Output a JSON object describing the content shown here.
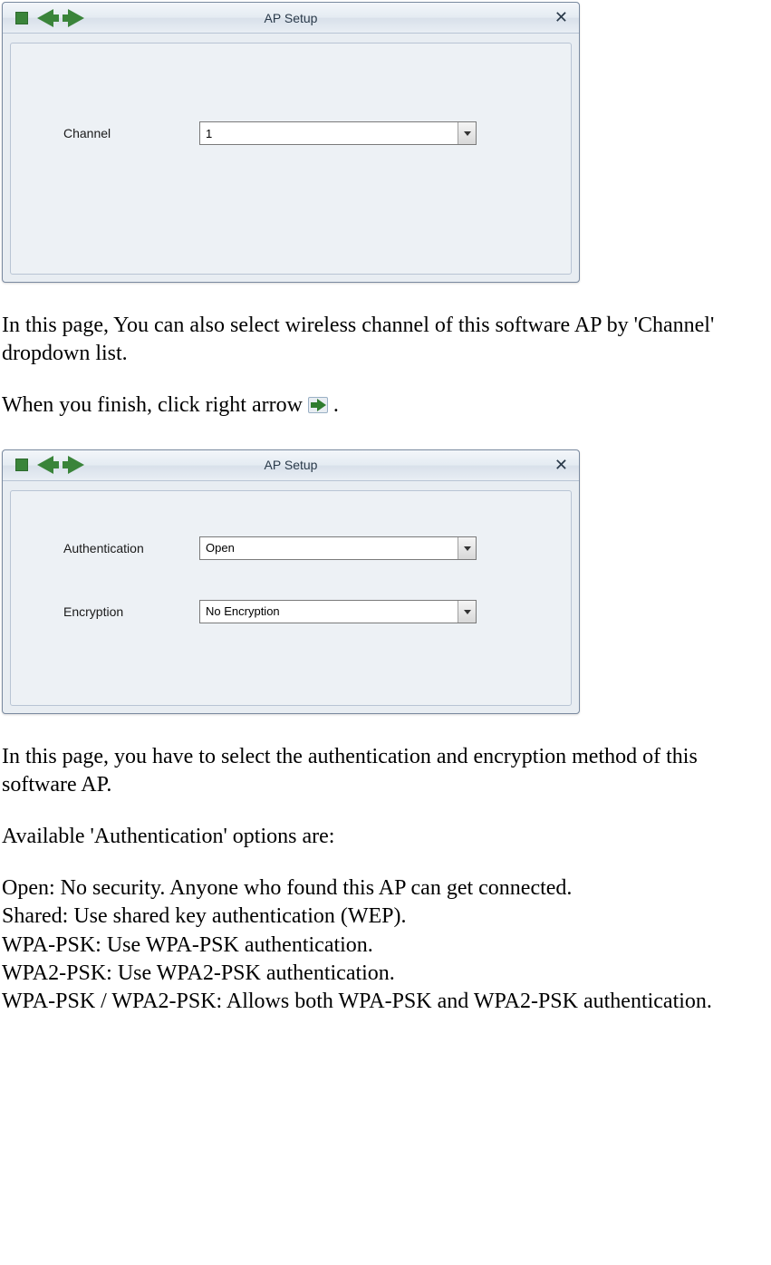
{
  "win1": {
    "title": "AP Setup",
    "label_channel": "Channel",
    "channel_value": "1"
  },
  "text1": "In this page, You can also select wireless channel of this software AP by 'Channel' dropdown list.",
  "text2a": "When you finish, click right arrow ",
  "text2b": " .",
  "win2": {
    "title": "AP Setup",
    "label_auth": "Authentication",
    "auth_value": "Open",
    "label_enc": "Encryption",
    "enc_value": "No Encryption"
  },
  "text3": "In this page, you have to select the authentication and encryption method of this software AP.",
  "text4": "Available 'Authentication' options are:",
  "opts": {
    "o1": "Open: No security. Anyone who found this AP can get connected.",
    "o2": "Shared: Use shared key authentication (WEP).",
    "o3": "WPA-PSK: Use WPA-PSK authentication.",
    "o4": "WPA2-PSK: Use WPA2-PSK authentication.",
    "o5": "WPA-PSK / WPA2-PSK: Allows both WPA-PSK and WPA2-PSK authentication."
  }
}
